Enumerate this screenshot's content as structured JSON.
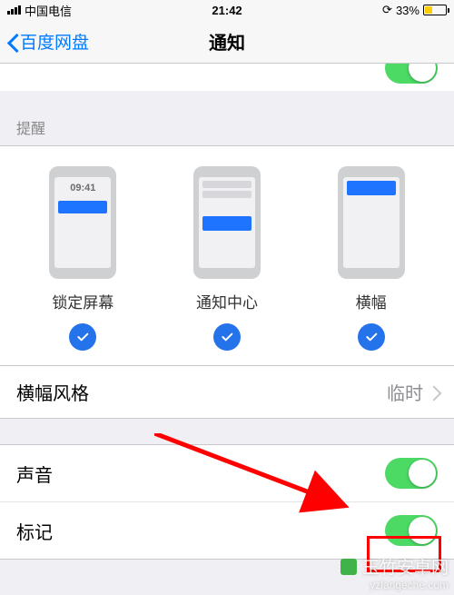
{
  "statusBar": {
    "carrier": "中国电信",
    "time": "21:42",
    "batteryPercent": "33%",
    "batteryFillPct": 33
  },
  "nav": {
    "backLabel": "百度网盘",
    "title": "通知"
  },
  "partialRow": {
    "hiddenText": ""
  },
  "alertSection": {
    "header": "提醒",
    "items": [
      {
        "key": "lock",
        "label": "锁定屏幕",
        "time": "09:41"
      },
      {
        "key": "center",
        "label": "通知中心"
      },
      {
        "key": "banner",
        "label": "横幅"
      }
    ]
  },
  "rows": {
    "bannerStyle": {
      "label": "横幅风格",
      "value": "临时"
    },
    "sound": {
      "label": "声音"
    },
    "badge": {
      "label": "标记"
    }
  },
  "watermark": {
    "cn": "玉竹安卓网",
    "en": "yzlangeche.com"
  }
}
